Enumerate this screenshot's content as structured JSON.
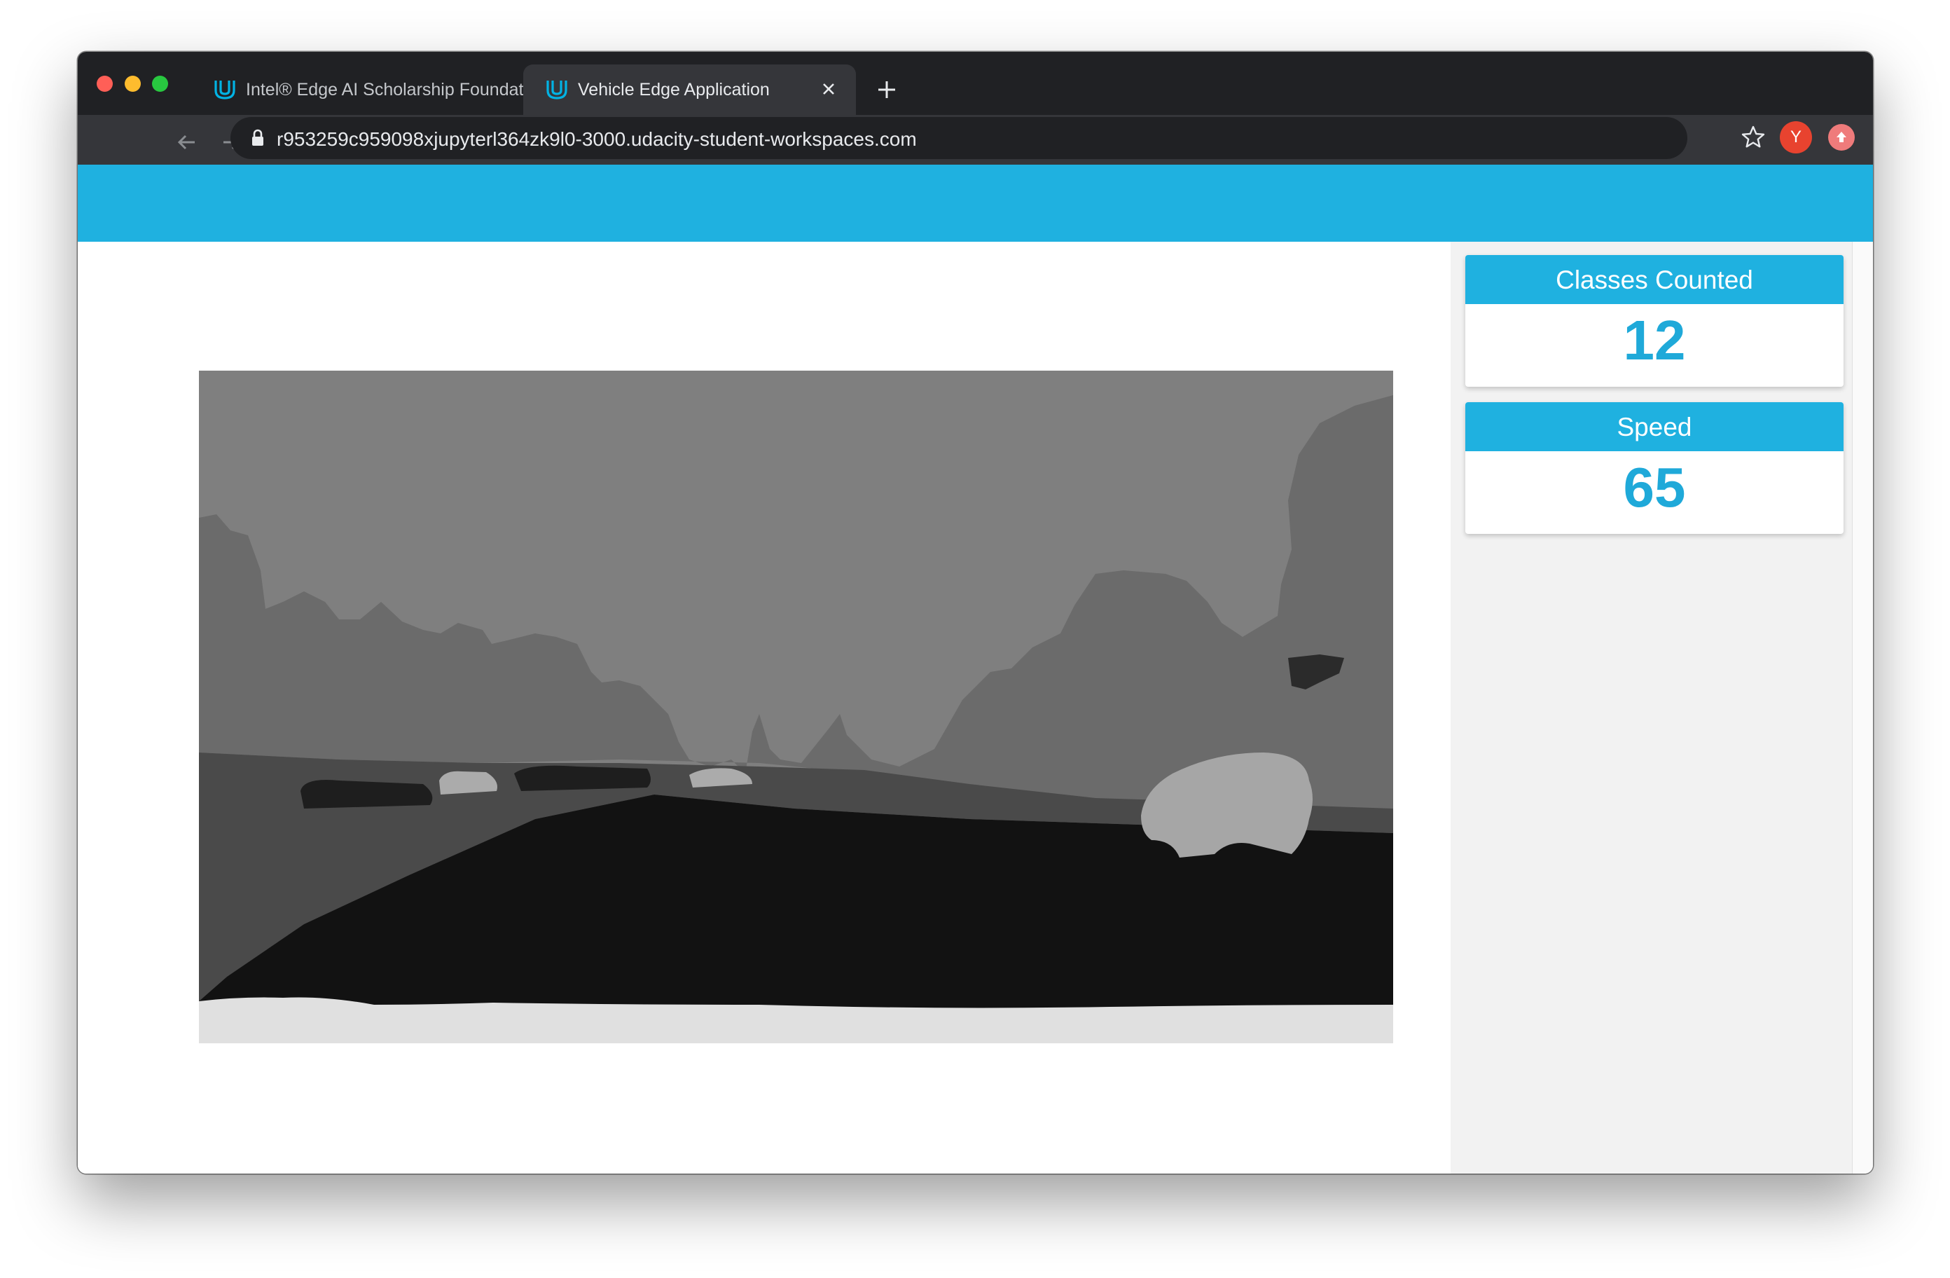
{
  "browser": {
    "tabs": [
      {
        "title": "Intel® Edge AI Scholarship Foundation",
        "active": false,
        "favicon": "udacity-logo-icon"
      },
      {
        "title": "Vehicle Edge Application",
        "active": true,
        "favicon": "udacity-logo-icon"
      }
    ],
    "url": "r953259c959098xjupyterl364zk9l0-3000.udacity-student-workspaces.com",
    "profile_initial": "Y",
    "icons": [
      "back-arrow-icon",
      "forward-arrow-icon",
      "reload-icon",
      "lock-icon",
      "bookmark-star-icon",
      "extension-icon",
      "close-icon",
      "new-tab-plus-icon"
    ]
  },
  "app": {
    "header_color": "#1fb1e0",
    "frame": {
      "description_type": "semantic-segmentation-output",
      "palette": [
        "#7f7f7f",
        "#6b6b6b",
        "#4a4a4a",
        "#121212",
        "#1e1e1e",
        "#ababab",
        "#e0e0e0"
      ]
    },
    "stats": [
      {
        "label": "Classes Counted",
        "value": "12"
      },
      {
        "label": "Speed",
        "value": "65"
      }
    ]
  }
}
